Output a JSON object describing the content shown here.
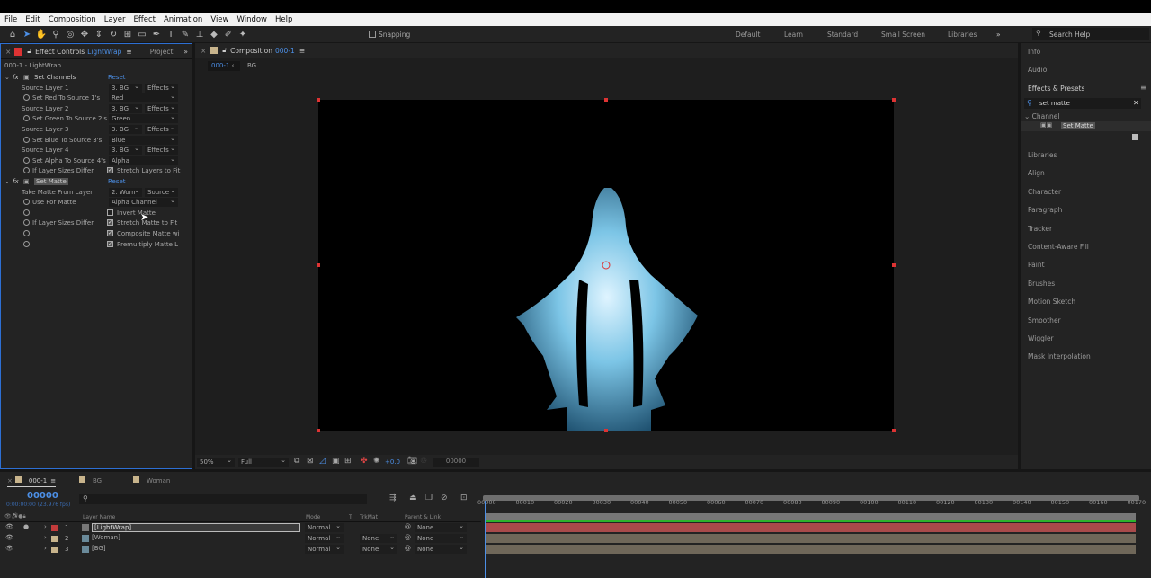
{
  "menu": [
    "File",
    "Edit",
    "Composition",
    "Layer",
    "Effect",
    "Animation",
    "View",
    "Window",
    "Help"
  ],
  "toolbar": {
    "snapping": "Snapping",
    "workspaces": [
      "Default",
      "Learn",
      "Standard",
      "Small Screen",
      "Libraries"
    ],
    "search_help": "Search Help"
  },
  "effect_controls": {
    "tab_label": "Effect Controls",
    "tab_layer": "LightWrap",
    "project_tab": "Project",
    "subtitle": "000-1 - LightWrap",
    "set_channels": {
      "name": "Set Channels",
      "reset": "Reset",
      "rows": [
        {
          "label": "Source Layer 1",
          "layer": "3. BG",
          "src": "Effects"
        },
        {
          "label": "Set Red To Source 1's",
          "value": "Red"
        },
        {
          "label": "Source Layer 2",
          "layer": "3. BG",
          "src": "Effects"
        },
        {
          "label": "Set Green To Source 2's",
          "value": "Green"
        },
        {
          "label": "Source Layer 3",
          "layer": "3. BG",
          "src": "Effects"
        },
        {
          "label": "Set Blue To Source 3's",
          "value": "Blue"
        },
        {
          "label": "Source Layer 4",
          "layer": "3. BG",
          "src": "Effects"
        },
        {
          "label": "Set Alpha To Source 4's",
          "value": "Alpha"
        },
        {
          "label": "If Layer Sizes Differ",
          "check": "Stretch Layers to Fit"
        }
      ]
    },
    "set_matte": {
      "name": "Set Matte",
      "reset": "Reset",
      "take_label": "Take Matte From Layer",
      "take_layer": "2. Wom",
      "take_src": "Source",
      "use_label": "Use For Matte",
      "use_value": "Alpha Channel",
      "invert": "Invert Matte",
      "differ_label": "If Layer Sizes Differ",
      "stretch": "Stretch Matte to Fit",
      "composite": "Composite Matte wi",
      "premultiply": "Premultiply Matte L"
    }
  },
  "composition": {
    "tab_label": "Composition",
    "comp_name": "000-1",
    "crumb_active": "000-1",
    "crumb_next": "BG",
    "zoom": "50%",
    "resolution": "Full",
    "exposure": "+0.0",
    "timecode": "00000"
  },
  "right_panel": {
    "info": "Info",
    "audio": "Audio",
    "effects_presets": "Effects & Presets",
    "search_value": "set matte",
    "category": "Channel",
    "result": "Set Matte",
    "items": [
      "Libraries",
      "Align",
      "Character",
      "Paragraph",
      "Tracker",
      "Content-Aware Fill",
      "Paint",
      "Brushes",
      "Motion Sketch",
      "Smoother",
      "Wiggler",
      "Mask Interpolation"
    ]
  },
  "timeline": {
    "tabs": [
      "000-1",
      "BG",
      "Woman"
    ],
    "current_time": "00000",
    "time_detail": "0:00:00:00 (23.976 fps)",
    "columns": {
      "layer_name": "Layer Name",
      "mode": "Mode",
      "t": "T",
      "trkmat": "TrkMat",
      "parent": "Parent & Link"
    },
    "layers": [
      {
        "num": "1",
        "name": "[LightWrap]",
        "mode": "Normal",
        "trkmat": "",
        "parent": "None",
        "color": "#c23b3b"
      },
      {
        "num": "2",
        "name": "[Woman]",
        "mode": "Normal",
        "trkmat": "None",
        "parent": "None",
        "color": "#c8b48c"
      },
      {
        "num": "3",
        "name": "[BG]",
        "mode": "Normal",
        "trkmat": "None",
        "parent": "None",
        "color": "#c8b48c"
      }
    ],
    "ruler": [
      "00000",
      "00010",
      "00020",
      "00030",
      "00040",
      "00050",
      "00060",
      "00070",
      "00080",
      "00090",
      "00100",
      "00110",
      "00120",
      "00130",
      "00140",
      "00150",
      "00160",
      "00170"
    ]
  }
}
